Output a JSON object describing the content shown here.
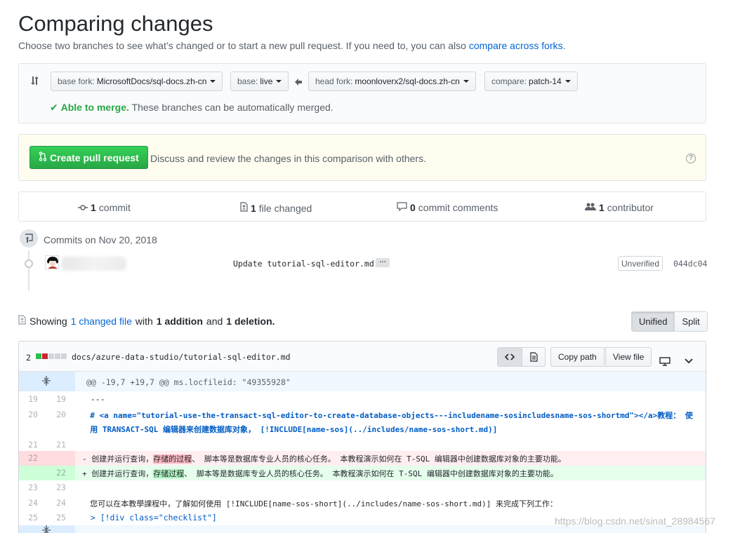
{
  "page": {
    "title": "Comparing changes",
    "subtitle": "Choose two branches to see what’s changed or to start a new pull request. If you need to, you can also",
    "subtitle_link": "compare across forks",
    "subtitle_end": "."
  },
  "range": {
    "base_fork_label": "base fork:",
    "base_fork_value": "MicrosoftDocs/sql-docs.zh-cn",
    "base_label": "base:",
    "base_value": "live",
    "head_fork_label": "head fork:",
    "head_fork_value": "moonloverx2/sql-docs.zh-cn",
    "compare_label": "compare:",
    "compare_value": "patch-14",
    "merge_status": "Able to merge.",
    "merge_text": "These branches can be automatically merged."
  },
  "pull_request": {
    "button_label": "Create pull request",
    "description": "Discuss and review the changes in this comparison with others."
  },
  "stats": {
    "commits_count": "1",
    "commits_label": "commit",
    "files_count": "1",
    "files_label": "file changed",
    "comments_count": "0",
    "comments_label": "commit comments",
    "contributors_count": "1",
    "contributors_label": "contributor"
  },
  "commits": {
    "date_label": "Commits on Nov 20, 2018",
    "message": "Update tutorial-sql-editor.md",
    "more": "…",
    "verification": "Unverified",
    "sha": "044dc04"
  },
  "summary": {
    "showing": "Showing",
    "changed_file": "1 changed file",
    "with": "with",
    "additions": "1 addition",
    "and": "and",
    "deletions": "1 deletion."
  },
  "view_toggle": {
    "unified": "Unified",
    "split": "Split"
  },
  "file": {
    "diffstat_count": "2",
    "path": "docs/azure-data-studio/tutorial-sql-editor.md",
    "copy_path": "Copy path",
    "view_file": "View file",
    "hunk_header": "@@ -19,7 +19,7 @@ ms.locfileid: \"49355928\"",
    "lines": [
      {
        "old": "19",
        "new": "19",
        "text": "  ---"
      },
      {
        "old": "20",
        "new": "20",
        "text_a": "  # <a name=\"tutorial-use-the-transact-sql-editor-to-create-database-objects---includename-sosincludesname-sos-shortmd\"></a>教程： 使",
        "text_b": "  用 TRANSACT-SQL 编辑器来创建数据库对象， [!INCLUDE[name-sos](../includes/name-sos-short.md)]"
      },
      {
        "old": "21",
        "new": "21",
        "text": ""
      },
      {
        "old": "22",
        "new": "",
        "prefix": "- 创建并运行查询，",
        "highlight": "存储的过程",
        "suffix": "、 脚本等是数据库专业人员的核心任务。 本教程演示如何在 T-SQL 编辑器中创建数据库对象的主要功能。"
      },
      {
        "old": "",
        "new": "22",
        "prefix": "+ 创建并运行查询，",
        "highlight": "存储过程",
        "suffix": "、 脚本等是数据库专业人员的核心任务。 本教程演示如何在 T-SQL 编辑器中创建数据库对象的主要功能。"
      },
      {
        "old": "23",
        "new": "23",
        "text": ""
      },
      {
        "old": "24",
        "new": "24",
        "text": "  您可以在本教學課程中，了解如何使用 [!INCLUDE[name-sos-short](../includes/name-sos-short.md)] 来完成下列工作："
      },
      {
        "old": "25",
        "new": "25",
        "text": "  > [!div class=\"checklist\"]"
      }
    ]
  },
  "watermark": "https://blog.csdn.net/sinat_28984567",
  "colors": {
    "link": "#0366d6",
    "success": "#28a745",
    "deletion_bg": "#ffeef0",
    "addition_bg": "#e6ffed",
    "hunk_bg": "#f1f8ff"
  }
}
